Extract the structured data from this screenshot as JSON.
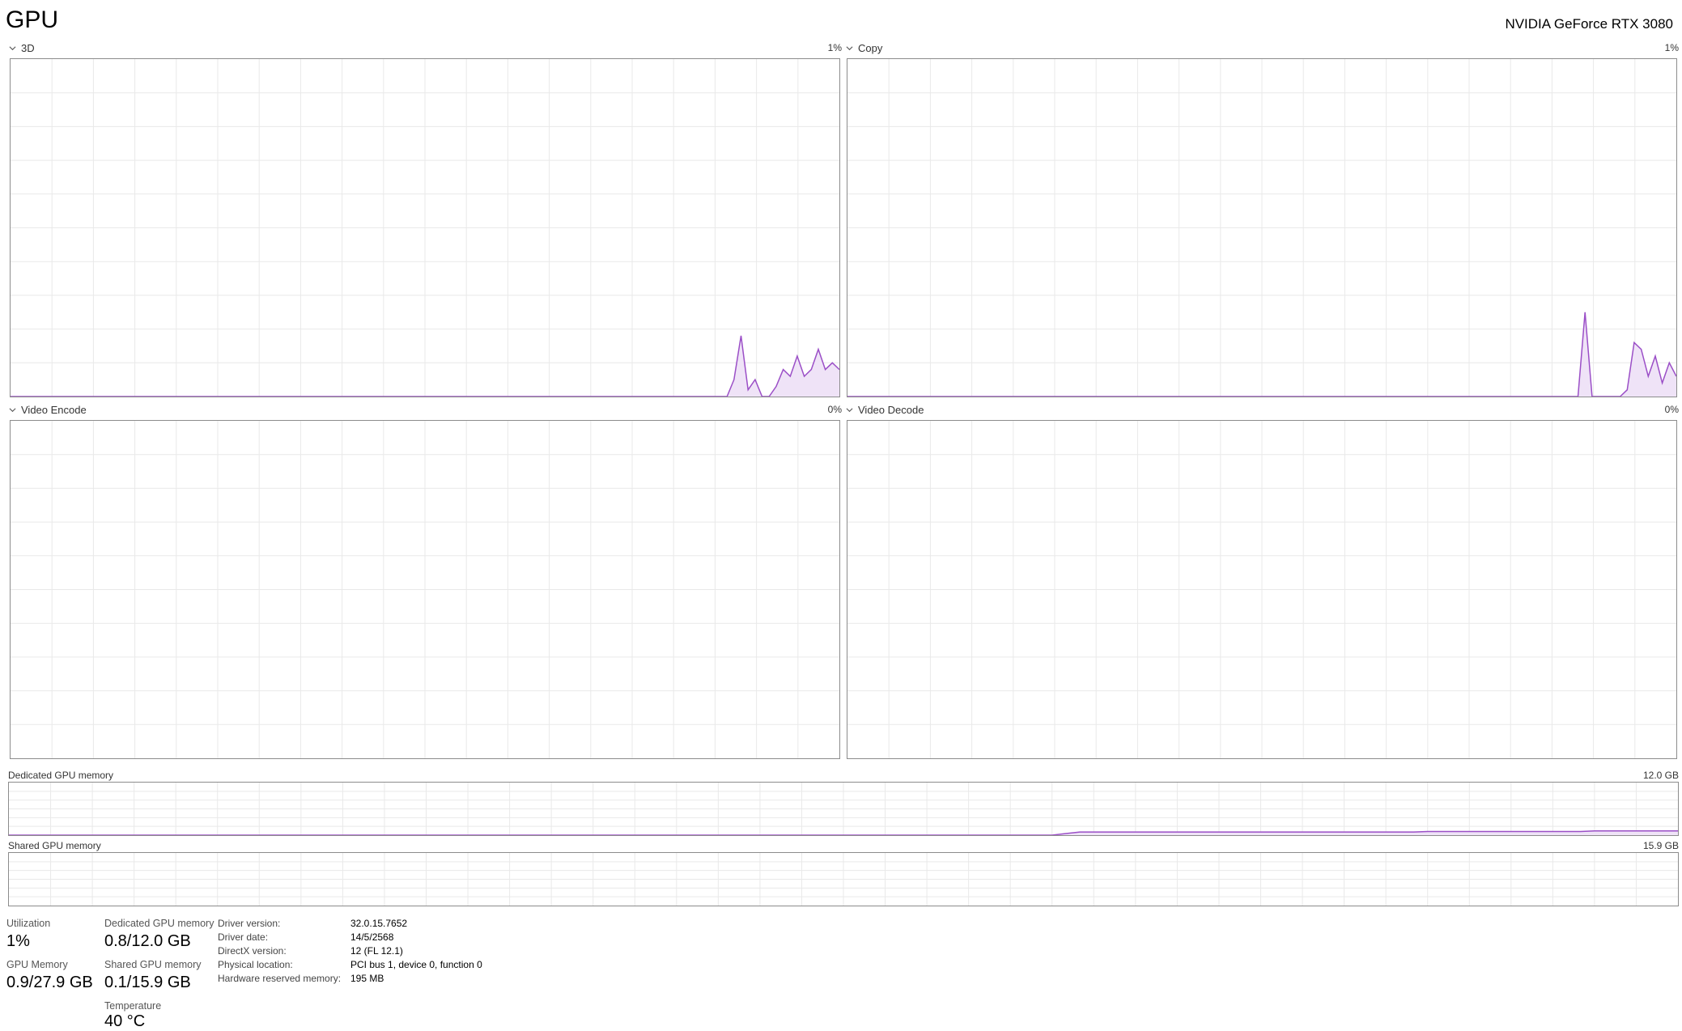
{
  "header": {
    "title": "GPU",
    "device_name": "NVIDIA GeForce RTX 3080"
  },
  "engines": [
    {
      "label": "3D",
      "max": "1%",
      "series": [
        0,
        0,
        0,
        0,
        0,
        0,
        0,
        0,
        0,
        0,
        0,
        0,
        0,
        0,
        0,
        0,
        0,
        0,
        0,
        0,
        0,
        0,
        0,
        0,
        0,
        0,
        0,
        0,
        0,
        0,
        0,
        0,
        0,
        0,
        0,
        0,
        0,
        0,
        0,
        0,
        0,
        0,
        0,
        0,
        0,
        0,
        0,
        0,
        0,
        0,
        0,
        0,
        0,
        0,
        0,
        0,
        0,
        0,
        0,
        0,
        0,
        0,
        0,
        0,
        0,
        0,
        0,
        0,
        0,
        0,
        0,
        0,
        0,
        0,
        0,
        0,
        0,
        0,
        0,
        0,
        0,
        0,
        0,
        0,
        0,
        0,
        0,
        0,
        0,
        0,
        0,
        0,
        0,
        0,
        0,
        0,
        0,
        0,
        0,
        0,
        0,
        0,
        0,
        0.05,
        0.18,
        0.02,
        0.05,
        0,
        0,
        0.03,
        0.08,
        0.06,
        0.12,
        0.06,
        0.08,
        0.14,
        0.08,
        0.1,
        0.08
      ]
    },
    {
      "label": "Copy",
      "max": "1%",
      "series": [
        0,
        0,
        0,
        0,
        0,
        0,
        0,
        0,
        0,
        0,
        0,
        0,
        0,
        0,
        0,
        0,
        0,
        0,
        0,
        0,
        0,
        0,
        0,
        0,
        0,
        0,
        0,
        0,
        0,
        0,
        0,
        0,
        0,
        0,
        0,
        0,
        0,
        0,
        0,
        0,
        0,
        0,
        0,
        0,
        0,
        0,
        0,
        0,
        0,
        0,
        0,
        0,
        0,
        0,
        0,
        0,
        0,
        0,
        0,
        0,
        0,
        0,
        0,
        0,
        0,
        0,
        0,
        0,
        0,
        0,
        0,
        0,
        0,
        0,
        0,
        0,
        0,
        0,
        0,
        0,
        0,
        0,
        0,
        0,
        0,
        0,
        0,
        0,
        0,
        0,
        0,
        0,
        0,
        0,
        0,
        0,
        0,
        0,
        0,
        0,
        0,
        0,
        0,
        0,
        0,
        0.25,
        0,
        0,
        0,
        0,
        0,
        0.02,
        0.16,
        0.14,
        0.06,
        0.12,
        0.04,
        0.1,
        0.06
      ]
    },
    {
      "label": "Video Encode",
      "max": "0%",
      "series": []
    },
    {
      "label": "Video Decode",
      "max": "0%",
      "series": []
    }
  ],
  "memory_graphs": [
    {
      "label": "Dedicated GPU memory",
      "max": "12.0 GB",
      "series": [
        0,
        0,
        0,
        0,
        0,
        0,
        0,
        0,
        0,
        0,
        0,
        0,
        0,
        0,
        0,
        0,
        0,
        0,
        0,
        0,
        0,
        0,
        0,
        0,
        0,
        0,
        0,
        0,
        0,
        0,
        0,
        0,
        0,
        0,
        0,
        0,
        0,
        0,
        0,
        0,
        0,
        0,
        0,
        0,
        0,
        0,
        0,
        0,
        0,
        0,
        0,
        0,
        0,
        0,
        0,
        0,
        0,
        0,
        0,
        0,
        0,
        0,
        0,
        0,
        0,
        0,
        0,
        0,
        0,
        0,
        0,
        0,
        0,
        0,
        0,
        0,
        0.03,
        0.06,
        0.06,
        0.06,
        0.06,
        0.06,
        0.06,
        0.06,
        0.06,
        0.06,
        0.06,
        0.06,
        0.06,
        0.06,
        0.06,
        0.06,
        0.06,
        0.06,
        0.06,
        0.06,
        0.06,
        0.06,
        0.06,
        0.06,
        0.06,
        0.06,
        0.07,
        0.07,
        0.07,
        0.07,
        0.07,
        0.07,
        0.07,
        0.07,
        0.07,
        0.07,
        0.07,
        0.07,
        0.08,
        0.08,
        0.08,
        0.08,
        0.08,
        0.08,
        0.08
      ]
    },
    {
      "label": "Shared GPU memory",
      "max": "15.9 GB",
      "series": []
    }
  ],
  "stats": {
    "utilization": {
      "label": "Utilization",
      "value": "1%"
    },
    "gpu_memory": {
      "label": "GPU Memory",
      "value": "0.9/27.9 GB"
    },
    "dedicated": {
      "label": "Dedicated GPU memory",
      "value": "0.8/12.0 GB"
    },
    "shared": {
      "label": "Shared GPU memory",
      "value": "0.1/15.9 GB"
    },
    "temperature": {
      "label": "Temperature",
      "value": "40 °C"
    }
  },
  "details": [
    {
      "key": "Driver version:",
      "value": "32.0.15.7652"
    },
    {
      "key": "Driver date:",
      "value": "14/5/2568"
    },
    {
      "key": "DirectX version:",
      "value": "12 (FL 12.1)"
    },
    {
      "key": "Physical location:",
      "value": "PCI bus 1, device 0, function 0"
    },
    {
      "key": "Hardware reserved memory:",
      "value": "195 MB"
    }
  ],
  "colors": {
    "line": "#9b4fc7",
    "fill": "#efe3f7",
    "grid": "#e9e9e9",
    "border": "#8c8c8c"
  },
  "icons": {
    "collapse": "chevron-down-icon"
  }
}
